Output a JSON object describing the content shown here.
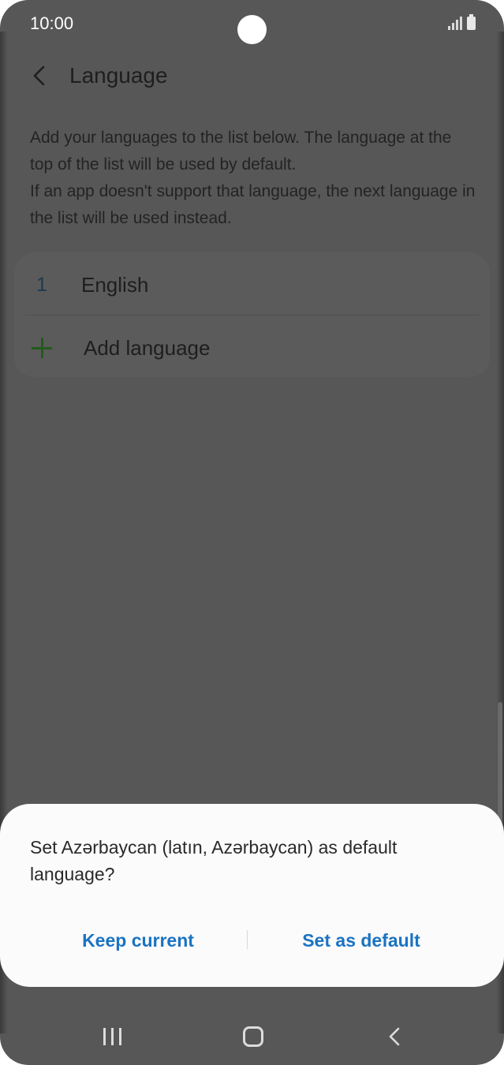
{
  "status_bar": {
    "time": "10:00",
    "icons": [
      "signal-icon",
      "battery-icon"
    ]
  },
  "header": {
    "back_icon": "chevron-left-icon",
    "title": "Language"
  },
  "description": {
    "line1": "Add your languages to the list below. The language at the top of the list will be used by default.",
    "line2": "If an app doesn't support that language, the next language in the list will be used instead."
  },
  "language_list": {
    "items": [
      {
        "index": "1",
        "name": "English"
      }
    ],
    "add_icon": "plus-icon",
    "add_label": "Add language"
  },
  "dialog": {
    "message": "Set Azərbaycan (latın, Azərbaycan) as default language?",
    "keep_label": "Keep current",
    "default_label": "Set as default"
  },
  "nav_bar": {
    "icons": [
      "recents-icon",
      "home-icon",
      "back-icon"
    ]
  },
  "colors": {
    "dim_background": "#575757",
    "accent_blue": "#1a73c2",
    "add_green": "#245a1d",
    "dialog_background": "#fbfbfb"
  }
}
